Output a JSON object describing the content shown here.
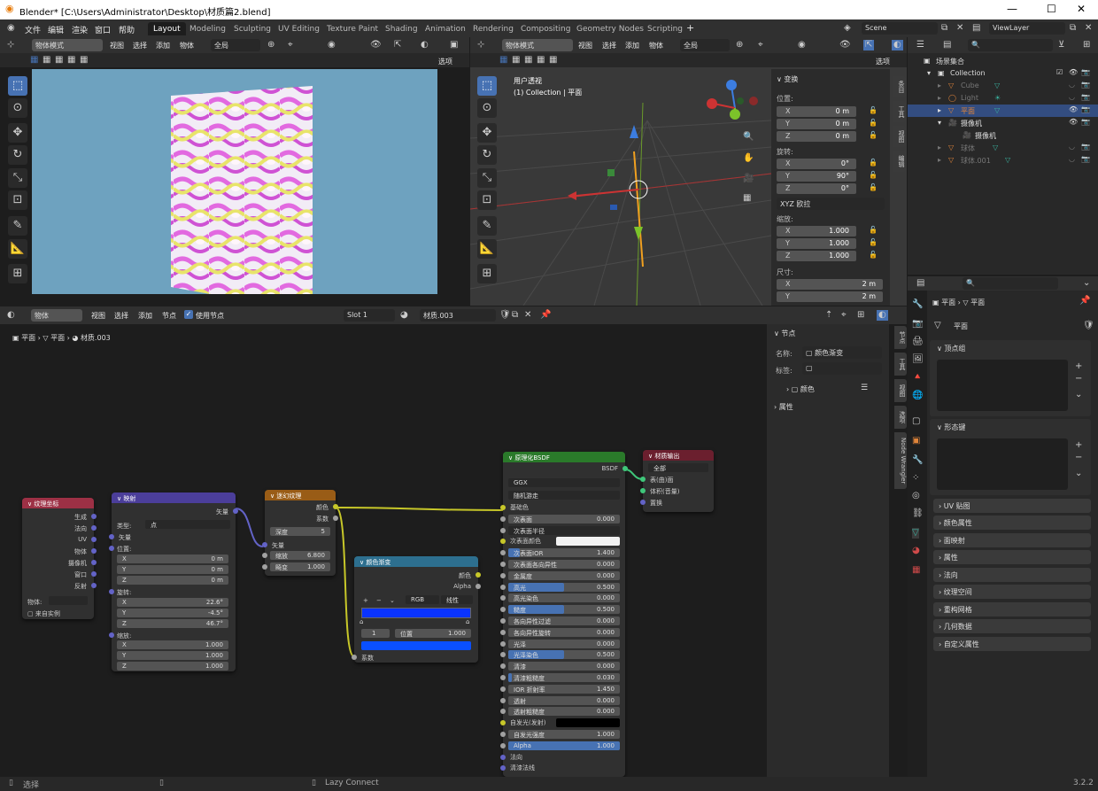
{
  "title_bar": {
    "title": "Blender* [C:\\Users\\Administrator\\Desktop\\材质篇2.blend]"
  },
  "menu": {
    "items": [
      "文件",
      "编辑",
      "渲染",
      "窗口",
      "帮助"
    ],
    "workspaces": [
      "Layout",
      "Modeling",
      "Sculpting",
      "UV Editing",
      "Texture Paint",
      "Shading",
      "Animation",
      "Rendering",
      "Compositing",
      "Geometry Nodes",
      "Scripting"
    ],
    "active_workspace": "Layout",
    "scene": "Scene",
    "view_layer": "ViewLayer"
  },
  "viewport_left": {
    "mode": "物体模式",
    "menus": [
      "视图",
      "选择",
      "添加",
      "物体"
    ],
    "transform": "全局",
    "options": "选项"
  },
  "viewport_right": {
    "mode": "物体模式",
    "menus": [
      "视图",
      "选择",
      "添加",
      "物体"
    ],
    "transform": "全局",
    "options": "选项",
    "overlay_line1": "用户透视",
    "overlay_line2": "(1) Collection | 平面",
    "tabs": [
      "条目",
      "工具",
      "视图",
      "编辑"
    ],
    "transform_panel": {
      "header": "变换",
      "location_label": "位置:",
      "location": [
        {
          "axis": "X",
          "value": "0 m"
        },
        {
          "axis": "Y",
          "value": "0 m"
        },
        {
          "axis": "Z",
          "value": "0 m"
        }
      ],
      "rotation_label": "旋转:",
      "rotation": [
        {
          "axis": "X",
          "value": "0°"
        },
        {
          "axis": "Y",
          "value": "90°"
        },
        {
          "axis": "Z",
          "value": "0°"
        }
      ],
      "rotation_mode": "XYZ 欧拉",
      "scale_label": "缩放:",
      "scale": [
        {
          "axis": "X",
          "value": "1.000"
        },
        {
          "axis": "Y",
          "value": "1.000"
        },
        {
          "axis": "Z",
          "value": "1.000"
        }
      ],
      "dimensions_label": "尺寸:",
      "dimensions": [
        {
          "axis": "X",
          "value": "2 m"
        },
        {
          "axis": "Y",
          "value": "2 m"
        }
      ]
    }
  },
  "outliner": {
    "root": "场景集合",
    "items": [
      {
        "name": "Collection",
        "indent": 1
      },
      {
        "name": "Cube",
        "indent": 2
      },
      {
        "name": "Light",
        "indent": 2
      },
      {
        "name": "平面",
        "indent": 2
      },
      {
        "name": "摄像机",
        "indent": 2
      },
      {
        "name": "摄像机",
        "indent": 3
      },
      {
        "name": "球体",
        "indent": 2
      },
      {
        "name": "球体.001",
        "indent": 2
      }
    ]
  },
  "properties": {
    "breadcrumb": [
      "平面",
      "平面"
    ],
    "data_name": "平面",
    "panels": [
      "顶点组",
      "形态键",
      "UV 贴图",
      "颜色属性",
      "面映射",
      "属性",
      "法向",
      "纹理空间",
      "重构网格",
      "几何数据",
      "自定义属性"
    ]
  },
  "node_editor": {
    "object_menu": "物体",
    "menus": [
      "视图",
      "选择",
      "添加",
      "节点"
    ],
    "use_nodes": "使用节点",
    "slot": "Slot 1",
    "material": "材质.003",
    "breadcrumb": [
      "平面",
      "平面",
      "材质.003"
    ],
    "sidebar": {
      "tabs": [
        "节点",
        "工具",
        "视图",
        "选项",
        "Node Wrangler"
      ],
      "node_header": "节点",
      "name_label": "名称:",
      "name_value": "颜色渐变",
      "label_label": "标签:",
      "color_label": "颜色",
      "properties_label": "属性"
    },
    "nodes": {
      "texcoord": {
        "title": "纹理坐标",
        "outputs": [
          "生成",
          "法向",
          "UV",
          "物体",
          "摄像机",
          "窗口",
          "反射"
        ],
        "object_label": "物体:",
        "from_instancer": "来自实例"
      },
      "mapping": {
        "title": "映射",
        "output": "矢量",
        "type_label": "类型:",
        "type_value": "点",
        "vector": "矢量",
        "location_label": "位置:",
        "location": [
          {
            "axis": "X",
            "value": "0 m"
          },
          {
            "axis": "Y",
            "value": "0 m"
          },
          {
            "axis": "Z",
            "value": "0 m"
          }
        ],
        "rotation_label": "旋转:",
        "rotation": [
          {
            "axis": "X",
            "value": "22.6°"
          },
          {
            "axis": "Y",
            "value": "-4.5°"
          },
          {
            "axis": "Z",
            "value": "46.7°"
          }
        ],
        "scale_label": "缩放:",
        "scale": [
          {
            "axis": "X",
            "value": "1.000"
          },
          {
            "axis": "Y",
            "value": "1.000"
          },
          {
            "axis": "Z",
            "value": "1.000"
          }
        ]
      },
      "magic": {
        "title": "迷幻纹理",
        "outputs": [
          "颜色",
          "系数"
        ],
        "depth_label": "深度",
        "depth_value": "5",
        "vector": "矢量",
        "scale_label": "缩放",
        "scale_value": "6.800",
        "distortion_label": "畸变",
        "distortion_value": "1.000"
      },
      "ramp": {
        "title": "颜色渐变",
        "outputs": [
          "颜色",
          "Alpha"
        ],
        "mode": "RGB",
        "interp": "线性",
        "index": "1",
        "pos_label": "位置",
        "pos_value": "1.000",
        "input": "系数"
      },
      "bsdf": {
        "title": "原理化BSDF",
        "output": "BSDF",
        "distribution": "GGX",
        "subsurface_method": "随机游走",
        "rows": [
          {
            "label": "基础色",
            "value": "",
            "type": "socket"
          },
          {
            "label": "次表面",
            "value": "0.000"
          },
          {
            "label": "次表面半径",
            "value": "",
            "type": "dropdown"
          },
          {
            "label": "次表面颜色",
            "value": "",
            "type": "color"
          },
          {
            "label": "次表面IOR",
            "value": "1.400",
            "fill": 0.1
          },
          {
            "label": "次表面各向异性",
            "value": "0.000"
          },
          {
            "label": "金属度",
            "value": "0.000"
          },
          {
            "label": "高光",
            "value": "0.500",
            "fill": 0.5
          },
          {
            "label": "高光染色",
            "value": "0.000"
          },
          {
            "label": "糙度",
            "value": "0.500",
            "fill": 0.5
          },
          {
            "label": "各向异性过滤",
            "value": "0.000"
          },
          {
            "label": "各向异性旋转",
            "value": "0.000"
          },
          {
            "label": "光泽",
            "value": "0.000"
          },
          {
            "label": "光泽染色",
            "value": "0.500",
            "fill": 0.5
          },
          {
            "label": "清漆",
            "value": "0.000"
          },
          {
            "label": "清漆粗糙度",
            "value": "0.030",
            "fill": 0.03
          },
          {
            "label": "IOR 折射率",
            "value": "1.450"
          },
          {
            "label": "透射",
            "value": "0.000"
          },
          {
            "label": "透射粗糙度",
            "value": "0.000"
          },
          {
            "label": "自发光(发射)",
            "value": "",
            "type": "black"
          },
          {
            "label": "自发光强度",
            "value": "1.000"
          },
          {
            "label": "Alpha",
            "value": "1.000",
            "fill": 1.0
          },
          {
            "label": "法向",
            "value": "",
            "type": "socket"
          },
          {
            "label": "清漆法线",
            "value": "",
            "type": "socket"
          }
        ]
      },
      "output": {
        "title": "材质输出",
        "target": "全部",
        "inputs": [
          "表(曲)面",
          "体积(音量)",
          "置换"
        ]
      }
    }
  },
  "status_bar": {
    "select": "选择",
    "lazy": "Lazy Connect",
    "version": "3.2.2"
  },
  "colors": {
    "accent": "#4772b3",
    "texcoord_header": "#9d3045",
    "mapping_header": "#4b3e9a",
    "texture_header": "#995c16",
    "ramp_header": "#2d6f8f",
    "shader_header": "#2a7a2a",
    "output_header": "#6b1f2e"
  }
}
